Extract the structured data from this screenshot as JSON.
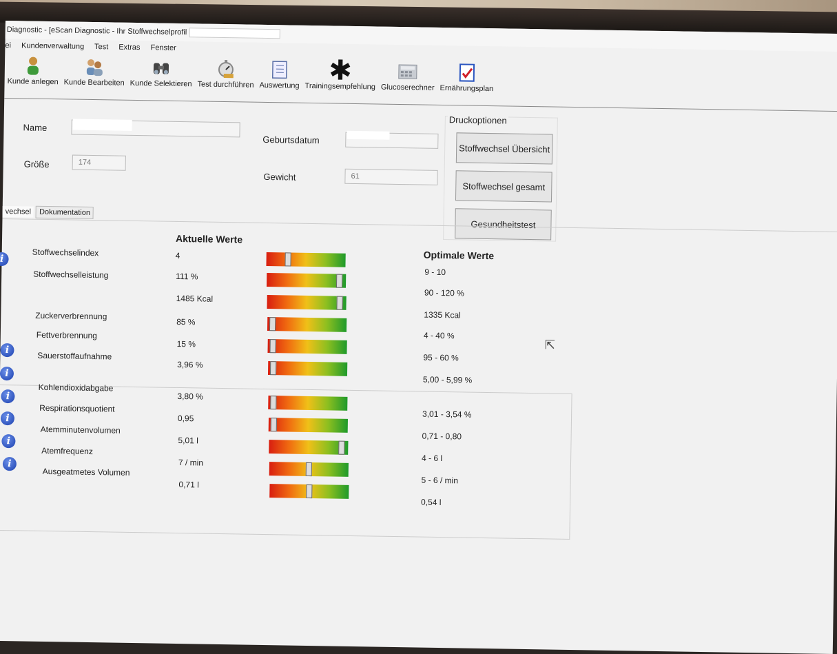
{
  "window": {
    "title": "Diagnostic - [eScan Diagnostic - Ihr Stoffwechselprofil"
  },
  "menu": [
    "ei",
    "Kundenverwaltung",
    "Test",
    "Extras",
    "Fenster"
  ],
  "toolbar": [
    {
      "label": "Kunde anlegen",
      "icon": "person-add-icon"
    },
    {
      "label": "Kunde Bearbeiten",
      "icon": "person-edit-icon"
    },
    {
      "label": "Kunde Selektieren",
      "icon": "binoculars-icon"
    },
    {
      "label": "Test durchführen",
      "icon": "stopwatch-icon"
    },
    {
      "label": "Auswertung",
      "icon": "checklist-icon"
    },
    {
      "label": "Trainingsempfehlung",
      "icon": "asterisk-icon"
    },
    {
      "label": "Glucoserechner",
      "icon": "calculator-icon"
    },
    {
      "label": "Ernährungsplan",
      "icon": "checkmark-document-icon"
    }
  ],
  "form": {
    "name_label": "Name",
    "groesse_label": "Größe",
    "groesse_value": "174",
    "geburtsdatum_label": "Geburtsdatum",
    "gewicht_label": "Gewicht",
    "gewicht_value": "61"
  },
  "druck": {
    "title": "Druckoptionen",
    "btn1": "Stoffwechsel Übersicht",
    "btn2": "Stoffwechsel gesamt",
    "btn3": "Gesundheitstest"
  },
  "tabs": {
    "active": "vechsel",
    "doc": "Dokumentation"
  },
  "headings": {
    "aktuelle": "Aktuelle Werte",
    "optimale": "Optimale Werte"
  },
  "rows": [
    {
      "label": "Stoffwechselindex",
      "value": "4",
      "level": 0.25
    },
    {
      "label": "Stoffwechselleistung",
      "value": "111 %",
      "level": 0.95
    },
    {
      "label": "",
      "value": "1485 Kcal",
      "level": 0.95
    },
    {
      "label": "Zuckerverbrennung",
      "value": "85 %",
      "level": 0.03
    },
    {
      "label": "Fettverbrennung",
      "value": "15 %",
      "level": 0.03
    },
    {
      "label": "Sauerstoffaufnahme",
      "value": "3,96 %",
      "level": 0.03
    },
    {
      "label": "Kohlendioxidabgabe",
      "value": "3,80 %",
      "level": 0.03
    },
    {
      "label": "Respirationsquotient",
      "value": "0,95",
      "level": 0.03
    },
    {
      "label": "Atemminutenvolumen",
      "value": "5,01 l",
      "level": 0.95
    },
    {
      "label": "Atemfrequenz",
      "value": "7 / min",
      "level": 0.5
    },
    {
      "label": "Ausgeatmetes Volumen",
      "value": "0,71 l",
      "level": 0.5
    }
  ],
  "optimal": [
    "9 - 10",
    "90 - 120 %",
    "1335 Kcal",
    "4 - 40 %",
    "95 - 60 %",
    "5,00 - 5,99 %",
    "3,01 - 3,54 %",
    "0,71 - 0,80",
    "4 - 6 l",
    "5 - 6 / min",
    "0,54 l"
  ],
  "info_icon": "i"
}
